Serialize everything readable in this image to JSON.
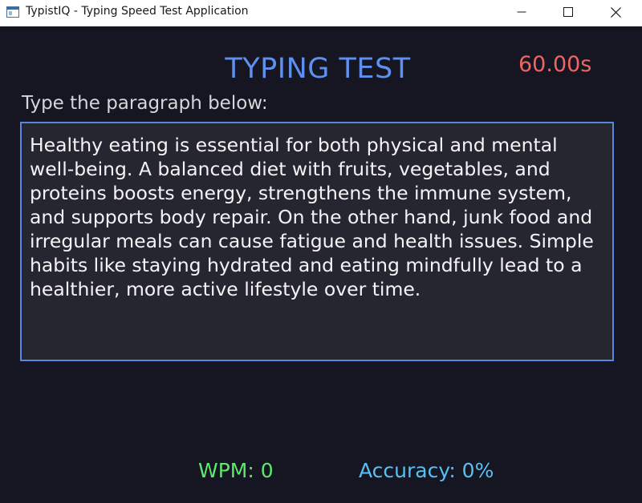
{
  "window": {
    "title": "TypistIQ - Typing Speed Test Application",
    "icons": [
      "app-icon",
      "minimize-icon",
      "maximize-icon",
      "close-icon"
    ]
  },
  "header": {
    "title": "TYPING TEST",
    "timer": "60.00s"
  },
  "main": {
    "prompt": "Type the paragraph below:",
    "paragraph": "Healthy eating is essential for both physical and mental\nwell-being. A balanced diet with fruits, vegetables, and\nproteins boosts energy, strengthens the immune system,\nand supports body repair. On the other hand, junk food and\nirregular meals can cause fatigue and health issues. Simple\nhabits like staying hydrated and eating mindfully lead to a\nhealthier, more active lifestyle over time."
  },
  "stats": {
    "wpm": "WPM: 0",
    "accuracy": "Accuracy: 0%"
  },
  "colors": {
    "background": "#151621",
    "title": "#5f8fef",
    "timer": "#ef6464",
    "wpm": "#5ee86d",
    "accuracy": "#58c0f2",
    "box_border": "#5a86dc",
    "box_fill": "#262631"
  }
}
